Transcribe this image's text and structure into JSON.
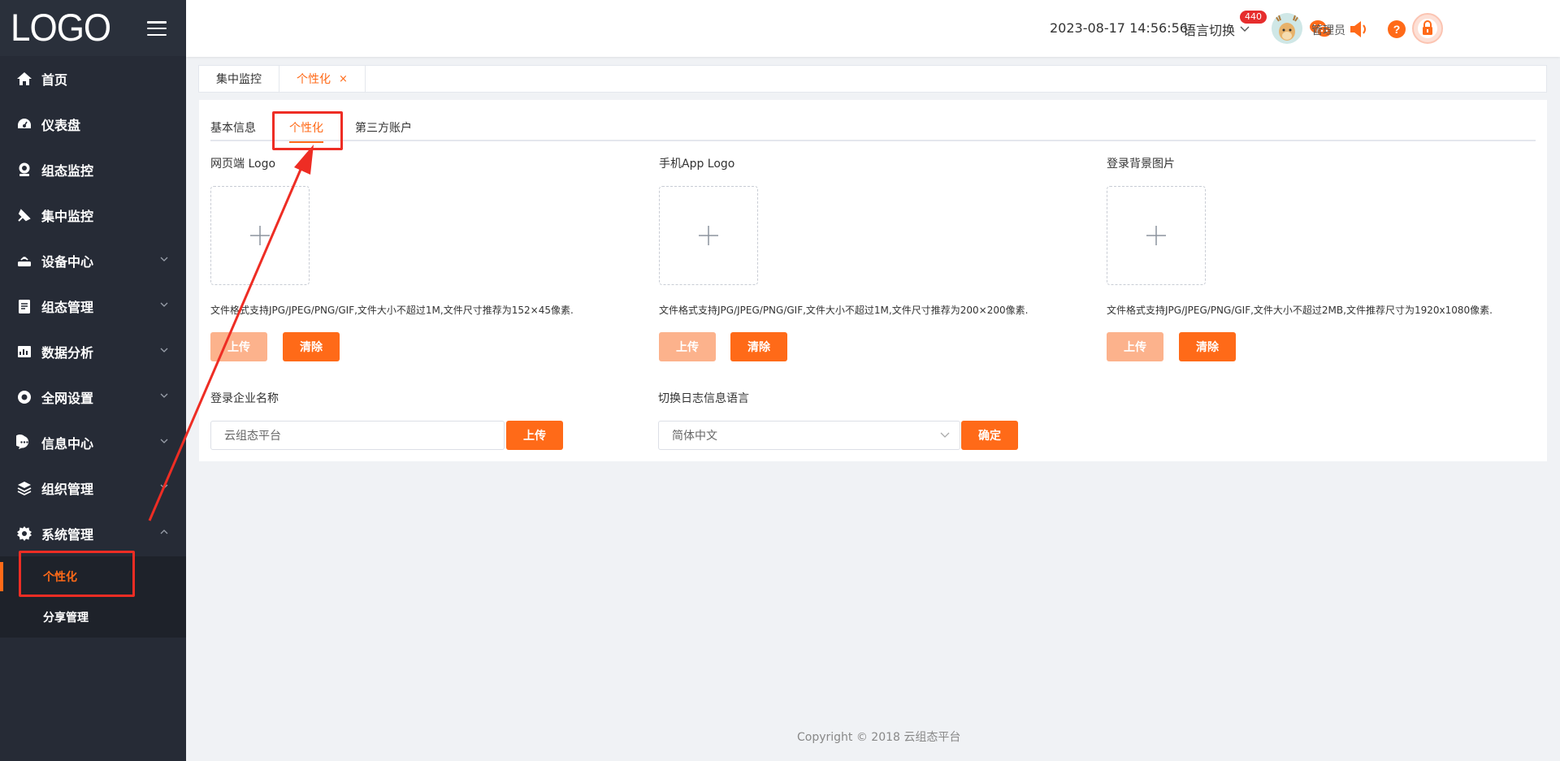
{
  "app": {
    "logo": "LOGO"
  },
  "sidebar": {
    "items": [
      {
        "label": "首页",
        "icon": "home-icon"
      },
      {
        "label": "仪表盘",
        "icon": "dashboard-icon"
      },
      {
        "label": "组态监控",
        "icon": "webcam-icon"
      },
      {
        "label": "集中监控",
        "icon": "satellite-icon"
      },
      {
        "label": "设备中心",
        "icon": "router-icon"
      },
      {
        "label": "组态管理",
        "icon": "clipboard-icon"
      },
      {
        "label": "数据分析",
        "icon": "chart-icon"
      },
      {
        "label": "全网设置",
        "icon": "target-icon"
      },
      {
        "label": "信息中心",
        "icon": "chat-icon"
      },
      {
        "label": "组织管理",
        "icon": "layers-icon"
      },
      {
        "label": "系统管理",
        "icon": "gear-icon"
      }
    ],
    "sub_items": [
      {
        "label": "个性化"
      },
      {
        "label": "分享管理"
      }
    ]
  },
  "header": {
    "datetime": "2023-08-17 14:56:56",
    "language": "语言切换",
    "alarm_count": "440",
    "user": "管理员"
  },
  "tabs": [
    {
      "label": "集中监控"
    },
    {
      "label": "个性化",
      "close": "×"
    }
  ],
  "panel": {
    "inner_tabs": [
      "基本信息",
      "个性化",
      "第三方账户"
    ],
    "uploads": [
      {
        "label": "网页端 Logo",
        "hint": "文件格式支持JPG/JPEG/PNG/GIF,文件大小不超过1M,文件尺寸推荐为152×45像素.",
        "upload": "上传",
        "clear": "清除"
      },
      {
        "label": "手机App Logo",
        "hint": "文件格式支持JPG/JPEG/PNG/GIF,文件大小不超过1M,文件尺寸推荐为200×200像素.",
        "upload": "上传",
        "clear": "清除"
      },
      {
        "label": "登录背景图片",
        "hint": "文件格式支持JPG/JPEG/PNG/GIF,文件大小不超过2MB,文件推荐尺寸为1920x1080像素.",
        "upload": "上传",
        "clear": "清除"
      }
    ],
    "company": {
      "label": "登录企业名称",
      "value": "云组态平台",
      "button": "上传"
    },
    "log_language": {
      "label": "切换日志信息语言",
      "value": "简体中文",
      "button": "确定"
    }
  },
  "footer": {
    "copyright": "Copyright © 2018 云组态平台"
  },
  "colors": {
    "accent": "#ff6a18",
    "sidebar": "#262b36",
    "annotation": "#ee2d24"
  }
}
